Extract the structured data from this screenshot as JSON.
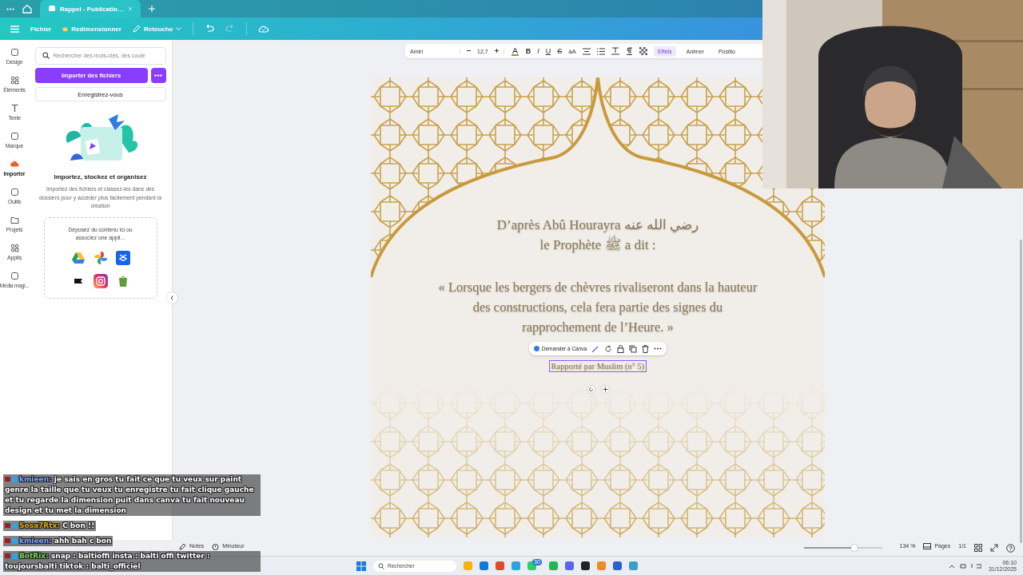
{
  "browser": {
    "tabs": [
      {
        "label": "Rappel - Publicatio…",
        "selected": true
      }
    ]
  },
  "menu": {
    "items": [
      "Fichier",
      "Redimensionner",
      "Retouche"
    ]
  },
  "rail": {
    "items": [
      {
        "label": "Design",
        "selected": false
      },
      {
        "label": "Éléments",
        "selected": false
      },
      {
        "label": "Texte",
        "selected": false
      },
      {
        "label": "Marque",
        "selected": false
      },
      {
        "label": "Importer",
        "selected": true
      },
      {
        "label": "Outils",
        "selected": false
      },
      {
        "label": "Projets",
        "selected": false
      },
      {
        "label": "Applis",
        "selected": false
      },
      {
        "label": "Média magi...",
        "selected": false
      }
    ]
  },
  "panel": {
    "search": {
      "placeholder": "Rechercher des mots-clés, des coule"
    },
    "import_button": "Importer des fichiers",
    "signup_button": "Enregistrez-vous",
    "heading": "Importez, stockez et organisez",
    "description": "Importez des fichiers et classez-les dans des dossiers pour y accéder plus facilement pendant la création",
    "drop_text": "Déposez du contenu ici ou associez une appli..."
  },
  "text_toolbar": {
    "font": "Amiri",
    "size": "12,7",
    "format_buttons": [
      {
        "kind": "bold",
        "label": "B"
      },
      {
        "kind": "italic",
        "label": "I"
      },
      {
        "kind": "underline",
        "label": "U"
      },
      {
        "kind": "strike",
        "label": "S"
      },
      {
        "kind": "case",
        "label": "aA"
      }
    ],
    "buttons": [
      {
        "label": "Effets",
        "selected": true
      },
      {
        "label": "Animer",
        "selected": false
      },
      {
        "label": "Positio",
        "selected": false
      }
    ]
  },
  "design": {
    "lines": [
      "D’après Abû Hourayra رضي الله عنه",
      "le Prophète ﷺ a dit :"
    ],
    "quote": "« Lorsque les bergers de chèvres rivaliseront dans la hauteur des constructions, cela fera partie des signes du rapprochement de l’Heure. »",
    "source": "Rapporté par Muslim (n° 5)",
    "action": "Demander à Canva"
  },
  "footer": {
    "notes": "Notes",
    "timer": "Minuteur",
    "zoom": {
      "level": 0.65,
      "reading": "134 %"
    },
    "pages": "Pages",
    "page_count": "1/1"
  },
  "taskbar": {
    "search": {
      "placeholder": "Rechercher"
    },
    "badge": "30",
    "time": "06:10",
    "date": "31/12/2025"
  },
  "chat": {
    "messages": [
      {
        "user": "kmieen:",
        "color": "#7aa4ff",
        "text": "je sais en gros tu fait ce que tu veux sur paint genre la taille que tu veux tu enregistre tu fait clique gauche et tu regarde la dimension puit dans canva tu fait nouveau design et tu met la dimension"
      },
      {
        "user": "Sosa7Rtx:",
        "color": "#d9a421",
        "text": "C bon !!"
      },
      {
        "user": "kmieen:",
        "color": "#7aa4ff",
        "text": "ahh bah c bon"
      },
      {
        "user": "BotRix:",
        "color": "#6cd23c",
        "text": "snap : baltioffi insta : balti offi twitter : toujoursbalti tiktok : balti_officiel"
      }
    ]
  }
}
